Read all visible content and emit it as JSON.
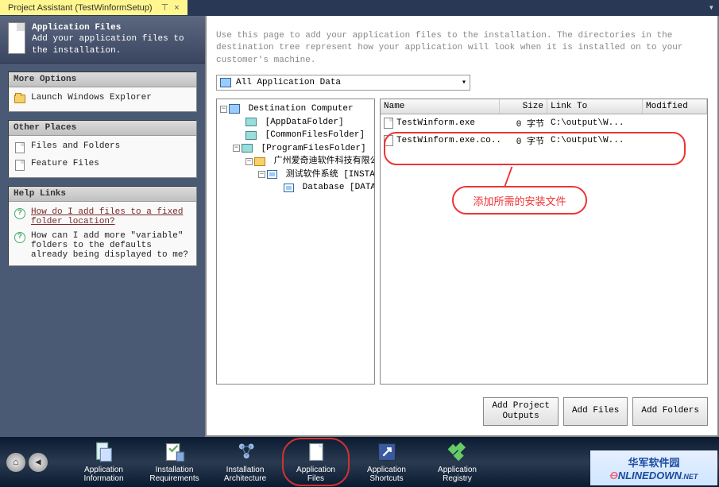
{
  "tab": {
    "title": "Project Assistant (TestWinformSetup)"
  },
  "header": {
    "title": "Application Files",
    "subtitle": "Add your application files to the installation."
  },
  "panels": {
    "more_options": {
      "title": "More Options",
      "launch_explorer": "Launch Windows Explorer"
    },
    "other_places": {
      "title": "Other Places",
      "files_folders": "Files and Folders",
      "feature_files": "Feature Files"
    },
    "help_links": {
      "title": "Help Links",
      "q1": "How do I add files to a fixed folder location?",
      "q2": "How can I add more \"variable\" folders to the defaults already being displayed to me?"
    }
  },
  "description": "Use this page to add your application files to the installation. The directories in the destination tree represent how your application will look when it is installed on to your customer's machine.",
  "combo": {
    "label": "All Application Data"
  },
  "tree": {
    "root": "Destination Computer",
    "n1": "[AppDataFolder]",
    "n2": "[CommonFilesFolder]",
    "n3": "[ProgramFilesFolder]",
    "n4": "广州爱奇迪软件科技有限公司",
    "n5": "测试软件系统 [INSTALLDIR]",
    "n6": "Database [DATABASE]"
  },
  "list": {
    "cols": {
      "name": "Name",
      "size": "Size",
      "link": "Link To",
      "mod": "Modified"
    },
    "rows": [
      {
        "name": "TestWinform.exe",
        "size": "0 字节",
        "link": "C:\\output\\W..."
      },
      {
        "name": "TestWinform.exe.co...",
        "size": "0 字节",
        "link": "C:\\output\\W..."
      }
    ]
  },
  "callout": "添加所需的安装文件",
  "buttons": {
    "add_outputs": "Add Project\nOutputs",
    "add_files": "Add Files",
    "add_folders": "Add Folders"
  },
  "nav": {
    "info": "Application\nInformation",
    "req": "Installation\nRequirements",
    "arch": "Installation\nArchitecture",
    "files": "Application\nFiles",
    "shortcuts": "Application\nShortcuts",
    "registry": "Application\nRegistry"
  },
  "watermark": {
    "cn": "华军软件园",
    "en": "ONLINEDOWN.NET"
  }
}
